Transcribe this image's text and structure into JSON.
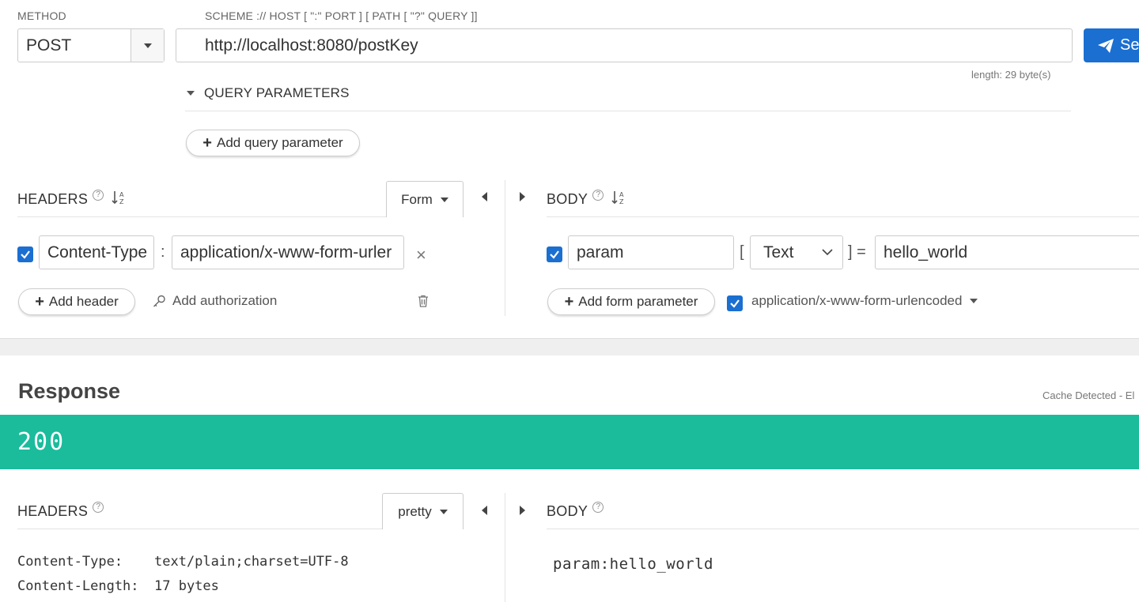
{
  "request": {
    "method_label": "METHOD",
    "method_value": "POST",
    "url_label": "SCHEME :// HOST [ \":\" PORT ] [ PATH [ \"?\" QUERY ]]",
    "url_value": "http://localhost:8080/postKey",
    "url_length": "length: 29 byte(s)",
    "send_label": "Se",
    "query_params_title": "QUERY PARAMETERS",
    "add_query_param": "Add query parameter"
  },
  "req_headers": {
    "title": "HEADERS",
    "mode": "Form",
    "header_name": "Content-Type",
    "header_sep": ":",
    "header_value": "application/x-www-form-urler",
    "add_header": "Add header",
    "add_auth": "Add authorization"
  },
  "req_body": {
    "title": "BODY",
    "param_name": "param",
    "bracket_open": "[",
    "param_type": "Text",
    "bracket_close": "] =",
    "param_value": "hello_world",
    "add_form_param": "Add form parameter",
    "content_type": "application/x-www-form-urlencoded"
  },
  "response": {
    "title": "Response",
    "cache_note": "Cache Detected - El",
    "status_code": "200",
    "status_color": "#1abc9c",
    "headers_title": "HEADERS",
    "headers_mode": "pretty",
    "headers": [
      {
        "name": "Content-Type:",
        "value": "text/plain;charset=UTF-8"
      },
      {
        "name": "Content-Length:",
        "value": "17 bytes"
      }
    ],
    "body_title": "BODY",
    "body_text": "param:hello_world"
  }
}
